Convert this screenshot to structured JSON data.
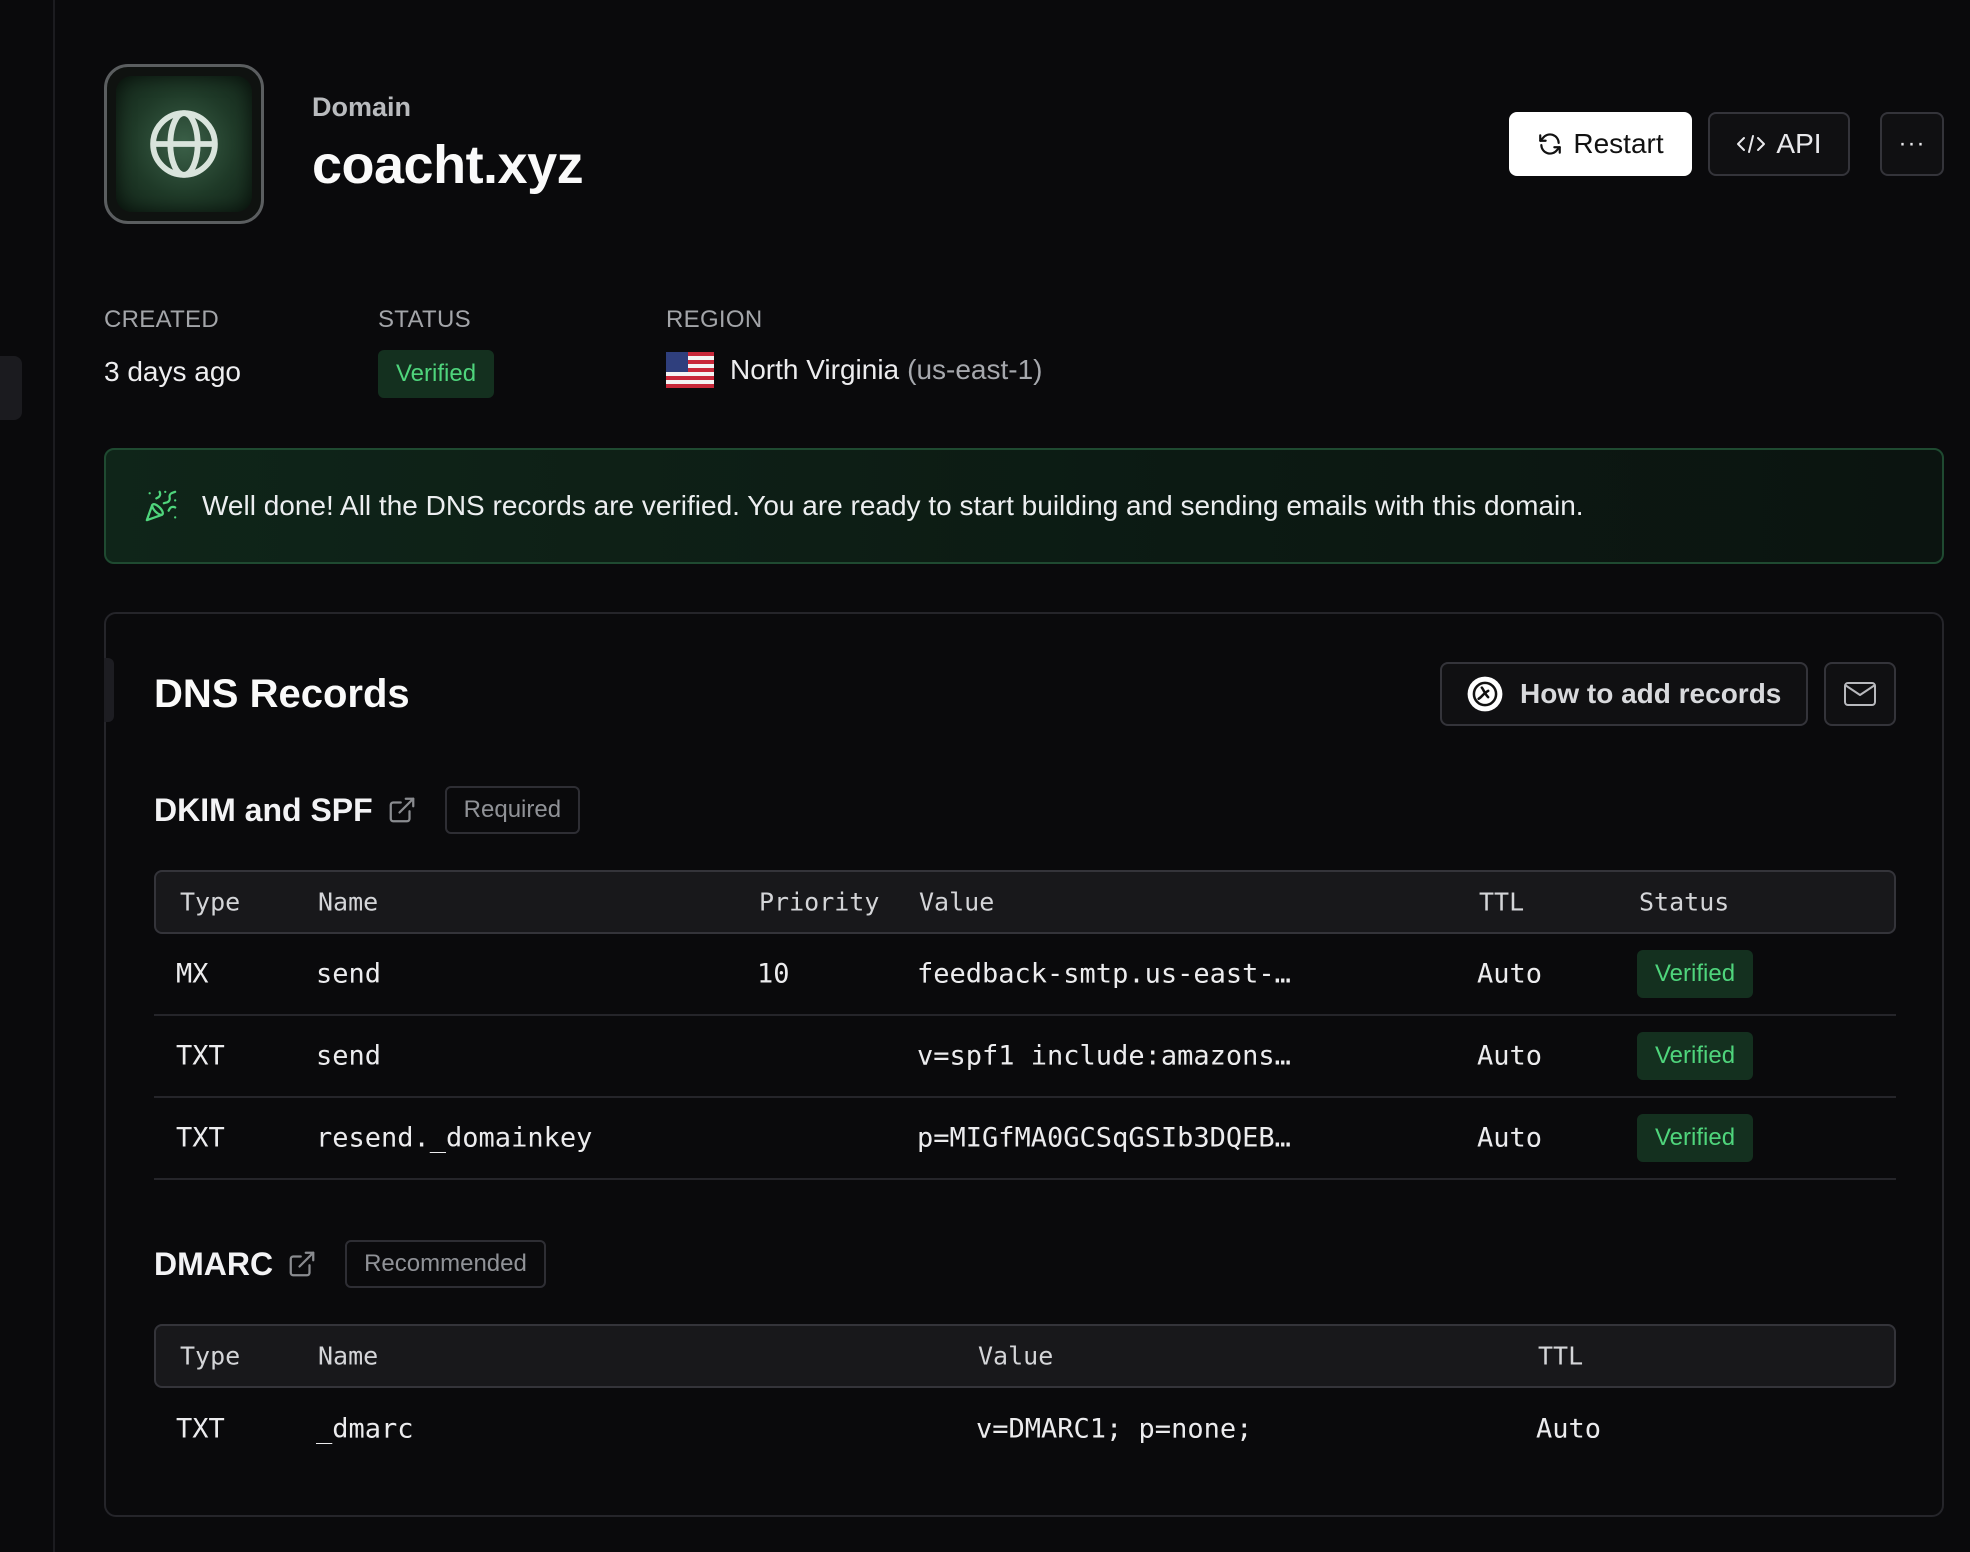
{
  "header": {
    "eyebrow": "Domain",
    "title": "coacht.xyz",
    "restart_label": "Restart",
    "api_label": "API",
    "more_label": "···"
  },
  "meta": {
    "created_label": "CREATED",
    "created_value": "3 days ago",
    "status_label": "STATUS",
    "status_value": "Verified",
    "region_label": "REGION",
    "region_name": "North Virginia",
    "region_code": "(us-east-1)"
  },
  "banner": {
    "text": "Well done! All the DNS records are verified. You are ready to start building and sending emails with this domain."
  },
  "dns": {
    "title": "DNS Records",
    "how_to_label": "How to add records",
    "dkim": {
      "title": "DKIM and SPF",
      "tag": "Required",
      "columns": [
        "Type",
        "Name",
        "Priority",
        "Value",
        "TTL",
        "Status"
      ],
      "rows": [
        {
          "type": "MX",
          "name": "send",
          "priority": "10",
          "value": "feedback-smtp.us-east-…",
          "ttl": "Auto",
          "status": "Verified"
        },
        {
          "type": "TXT",
          "name": "send",
          "priority": "",
          "value": "v=spf1 include:amazons…",
          "ttl": "Auto",
          "status": "Verified"
        },
        {
          "type": "TXT",
          "name": "resend._domainkey",
          "priority": "",
          "value": "p=MIGfMA0GCSqGSIb3DQEB…",
          "ttl": "Auto",
          "status": "Verified"
        }
      ]
    },
    "dmarc": {
      "title": "DMARC",
      "tag": "Recommended",
      "columns": [
        "Type",
        "Name",
        "Value",
        "TTL"
      ],
      "rows": [
        {
          "type": "TXT",
          "name": "_dmarc",
          "value": "v=DMARC1; p=none;",
          "ttl": "Auto"
        }
      ]
    }
  },
  "colors": {
    "background": "#0a0a0c",
    "verified_text": "#4fd57c",
    "verified_bg": "#14301f",
    "banner_border": "#1f4a31"
  },
  "icons": [
    "globe-icon",
    "refresh-icon",
    "code-icon",
    "ellipsis-icon",
    "party-popper-icon",
    "resend-logo-icon",
    "mail-icon",
    "external-link-icon",
    "us-flag-icon"
  ]
}
